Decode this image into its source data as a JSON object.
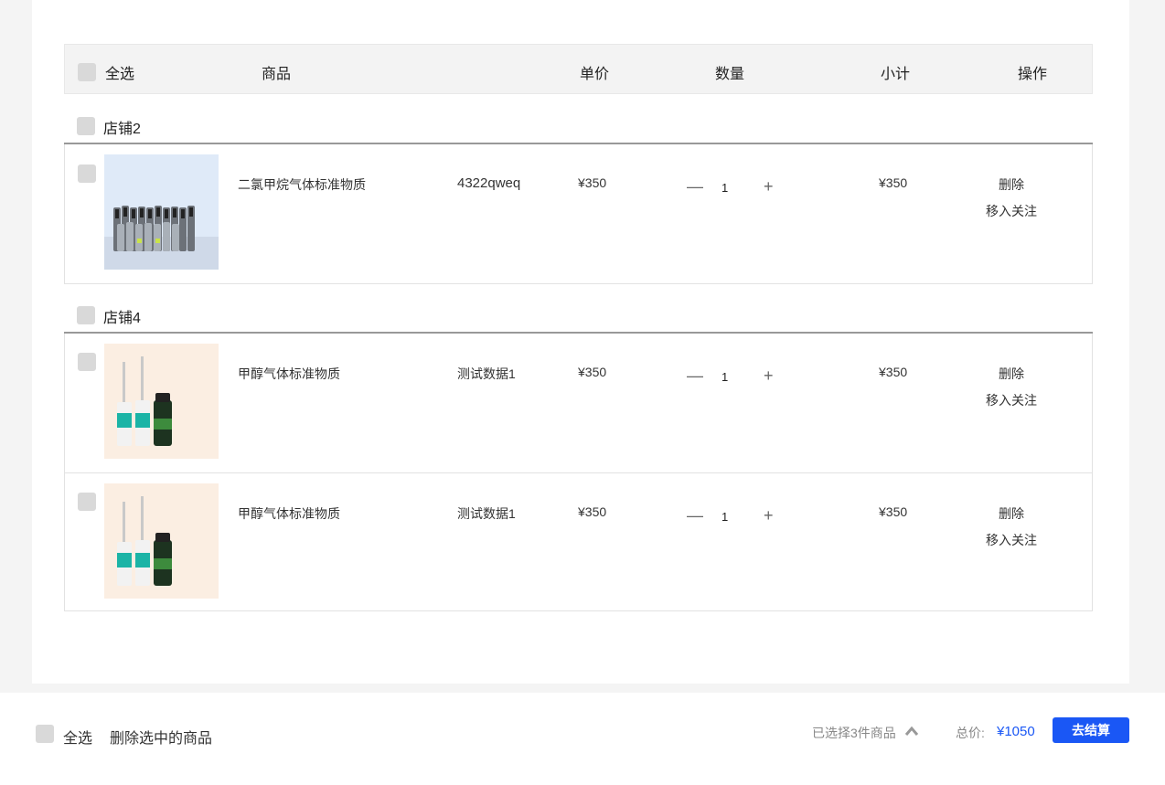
{
  "header": {
    "select_all": "全选",
    "product": "商品",
    "unit_price": "单价",
    "quantity": "数量",
    "subtotal": "小计",
    "actions": "操作"
  },
  "shops": [
    {
      "name": "店铺2",
      "items": [
        {
          "name": "二氯甲烷气体标准物质",
          "spec": "4322qweq",
          "price": "¥350",
          "qty": "1",
          "subtotal": "¥350",
          "delete": "删除",
          "follow": "移入关注",
          "image": "gas-cylinders-image"
        }
      ]
    },
    {
      "name": "店铺4",
      "items": [
        {
          "name": "甲醇气体标准物质",
          "spec": "测试数据1",
          "price": "¥350",
          "qty": "1",
          "subtotal": "¥350",
          "delete": "删除",
          "follow": "移入关注",
          "image": "vials-image"
        },
        {
          "name": "甲醇气体标准物质",
          "spec": "测试数据1",
          "price": "¥350",
          "qty": "1",
          "subtotal": "¥350",
          "delete": "删除",
          "follow": "移入关注",
          "image": "vials-image"
        }
      ]
    }
  ],
  "qty_controls": {
    "minus": "—",
    "plus": "+"
  },
  "footer": {
    "select_all": "全选",
    "delete_selected": "删除选中的商品",
    "selected_count": "已选择3件商品",
    "total_label": "总价:",
    "total_value": "¥1050",
    "checkout": "去结算"
  },
  "colors": {
    "accent": "#1a57f5",
    "checkbox": "#d9d9d9",
    "header_bg": "#f3f3f3"
  }
}
